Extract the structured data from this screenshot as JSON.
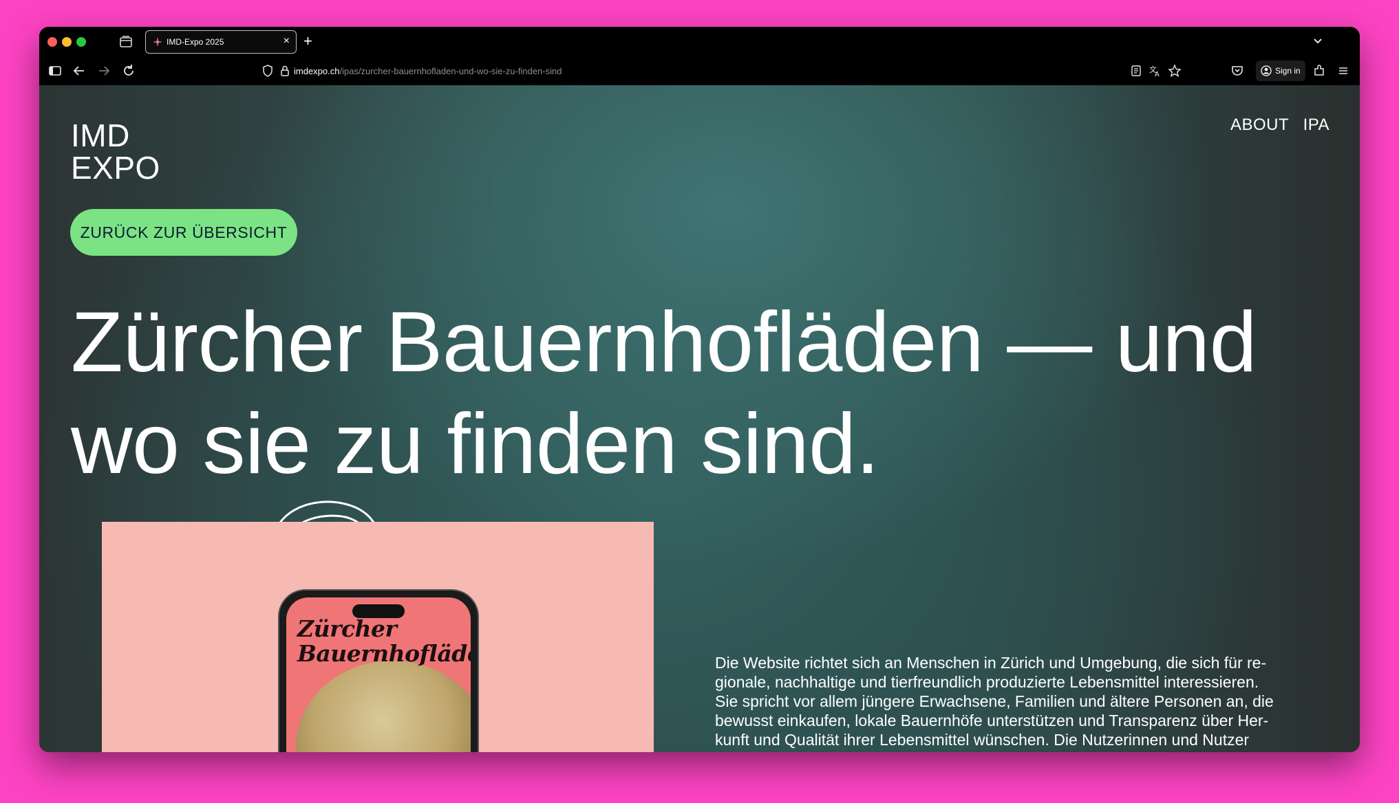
{
  "browser": {
    "tab_title": "IMD-Expo 2025",
    "tab_close": "×",
    "new_tab": "+",
    "url_host": "imdexpo.ch",
    "url_path": "/ipas/zurcher-bauernhofladen-und-wo-sie-zu-finden-sind",
    "sign_in": "Sign in",
    "icons": [
      "sidebar-icon",
      "back-icon",
      "forward-icon",
      "reload-icon",
      "shield-icon",
      "lock-icon",
      "reader-view-icon",
      "translate-icon",
      "bookmark-star-icon",
      "pocket-icon",
      "account-icon",
      "extensions-icon",
      "menu-icon"
    ]
  },
  "site": {
    "logo_line1": "IMD",
    "logo_line2": "EXPO",
    "nav": [
      "ABOUT",
      "IPA"
    ],
    "back_button": "ZURÜCK ZUR ÜBERSICHT",
    "headline": "Zürcher Bauernhofläden — und wo sie zu finden sind.",
    "phone_title_line1": "Zürcher",
    "phone_title_line2": "Bauernhofläden",
    "description_lines": [
      "Die Website richtet sich an Menschen in Zürich und Umgebung, die sich für re-",
      "gionale, nachhaltige und tierfreundlich produzierte Lebensmittel interessieren.",
      "Sie spricht vor allem jüngere Erwachsene, Familien und ältere Personen an, die",
      "bewusst einkaufen, lokale Bauernhöfe unterstützen und Transparenz über Her-",
      "kunft und Qualität ihrer Lebensmittel wünschen. Die Nutzerinnen und Nutzer"
    ]
  },
  "colors": {
    "backdrop": "#fd43c3",
    "button_green": "#7ce384",
    "button_text": "#0c1d33",
    "image_pink": "#f6bab2",
    "phone_screen": "#ef7576"
  }
}
